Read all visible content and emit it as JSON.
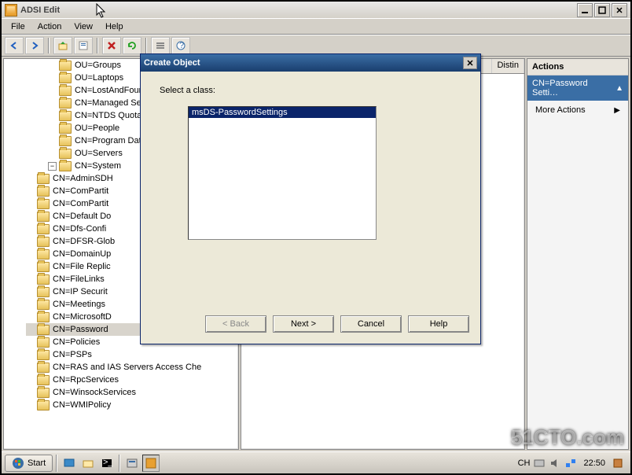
{
  "window": {
    "title": "ADSI Edit"
  },
  "menubar": [
    "File",
    "Action",
    "View",
    "Help"
  ],
  "list_pane": {
    "columns": [
      "Distin"
    ]
  },
  "actions": {
    "header": "Actions",
    "subheader": "CN=Password Setti…",
    "items": [
      "More Actions"
    ]
  },
  "tree": [
    {
      "label": "OU=Groups",
      "indent": 3
    },
    {
      "label": "OU=Laptops",
      "indent": 3
    },
    {
      "label": "CN=LostAndFound",
      "indent": 3,
      "truncated": true
    },
    {
      "label": "CN=Managed Serv",
      "indent": 3,
      "truncated": true
    },
    {
      "label": "CN=NTDS Quotas",
      "indent": 3
    },
    {
      "label": "OU=People",
      "indent": 3
    },
    {
      "label": "CN=Program Data",
      "indent": 3
    },
    {
      "label": "OU=Servers",
      "indent": 3
    },
    {
      "label": "CN=System",
      "indent": 3,
      "expanded": true,
      "children": [
        {
          "label": "CN=AdminSDH",
          "truncated": true
        },
        {
          "label": "CN=ComPartit",
          "truncated": true
        },
        {
          "label": "CN=ComPartit",
          "truncated": true
        },
        {
          "label": "CN=Default Do",
          "truncated": true
        },
        {
          "label": "CN=Dfs-Confi",
          "truncated": true
        },
        {
          "label": "CN=DFSR-Glob",
          "truncated": true
        },
        {
          "label": "CN=DomainUp",
          "truncated": true
        },
        {
          "label": "CN=File Replic",
          "truncated": true
        },
        {
          "label": "CN=FileLinks"
        },
        {
          "label": "CN=IP Securit",
          "truncated": true
        },
        {
          "label": "CN=Meetings"
        },
        {
          "label": "CN=MicrosoftD",
          "truncated": true
        },
        {
          "label": "CN=Password",
          "selected": true,
          "truncated": true
        },
        {
          "label": "CN=Policies"
        },
        {
          "label": "CN=PSPs"
        },
        {
          "label": "CN=RAS and IAS Servers Access Che",
          "truncated": true
        },
        {
          "label": "CN=RpcServices"
        },
        {
          "label": "CN=WinsockServices"
        },
        {
          "label": "CN=WMIPolicy"
        }
      ]
    }
  ],
  "dialog": {
    "title": "Create Object",
    "prompt": "Select a class:",
    "classes": [
      {
        "name": "msDS-PasswordSettings",
        "selected": true
      }
    ],
    "buttons": {
      "back": "< Back",
      "next": "Next >",
      "cancel": "Cancel",
      "help": "Help"
    }
  },
  "taskbar": {
    "start": "Start",
    "clock": "22:50",
    "lang": "CH"
  },
  "watermark": "51CTO.com"
}
